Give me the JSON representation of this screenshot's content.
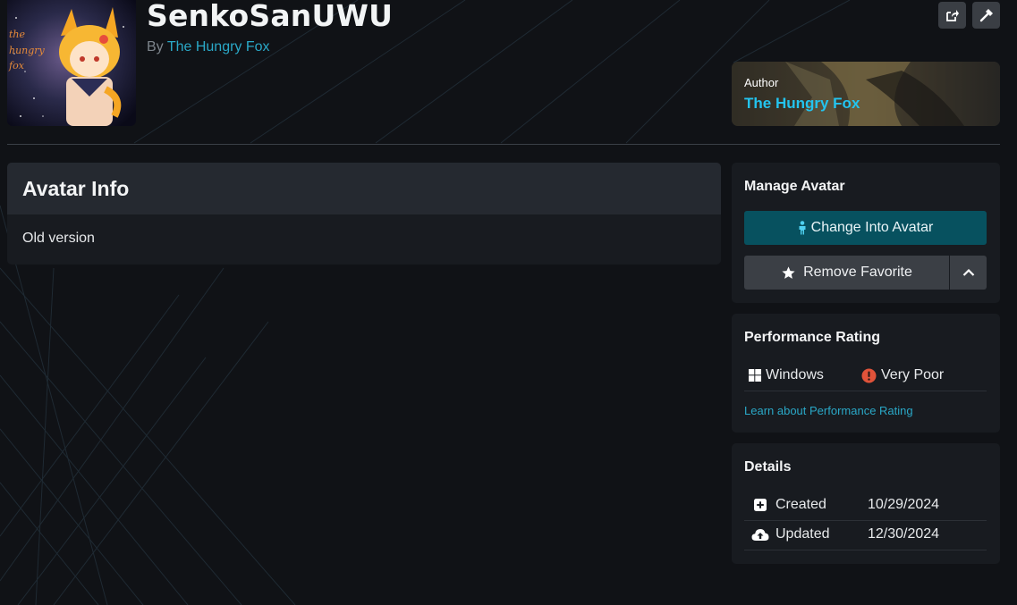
{
  "avatar": {
    "title": "SenkoSanUWU",
    "by_prefix": "By",
    "author_name": "The Hungry Fox",
    "thumbnail_text": "the hungry fox"
  },
  "header_actions": {
    "share_icon": "share-icon",
    "hammer_icon": "hammer-icon"
  },
  "author_card": {
    "label": "Author",
    "name": "The Hungry Fox"
  },
  "avatar_info": {
    "heading": "Avatar Info",
    "description": "Old version"
  },
  "manage": {
    "title": "Manage Avatar",
    "change_label": "Change Into Avatar",
    "favorite_label": "Remove Favorite"
  },
  "performance": {
    "title": "Performance Rating",
    "platform": "Windows",
    "rating": "Very Poor",
    "learn_link": "Learn about Performance Rating"
  },
  "details": {
    "title": "Details",
    "rows": [
      {
        "icon": "plus-square-icon",
        "label": "Created",
        "value": "10/29/2024"
      },
      {
        "icon": "cloud-upload-icon",
        "label": "Updated",
        "value": "12/30/2024"
      }
    ]
  },
  "colors": {
    "background": "#101216",
    "accent": "#2aa8c7",
    "primary_button": "#07515f",
    "very_poor": "#e0533a"
  }
}
